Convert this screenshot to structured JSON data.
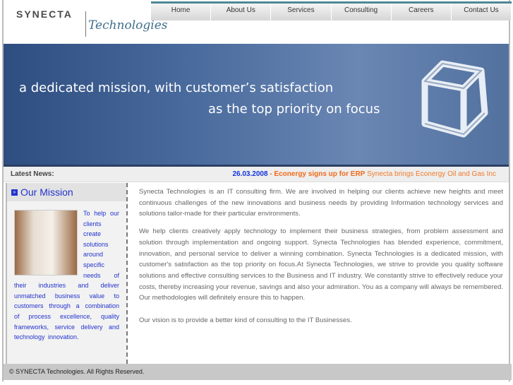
{
  "logo": {
    "name": "SYNECTA",
    "sub": "Technologies"
  },
  "nav": [
    "Home",
    "About Us",
    "Services",
    "Consulting",
    "Careers",
    "Contact Us"
  ],
  "banner": {
    "line1": "a dedicated mission, with customer’s satisfaction",
    "line2": "as the top priority on focus"
  },
  "news": {
    "label": "Latest News:",
    "date": "26.03.2008",
    "sep": " - ",
    "headline": "Econergy signs up for ERP",
    "text": " Synecta brings Econergy Oil and Gas Inc"
  },
  "sidebar": {
    "title": "Our Mission",
    "text": "To help our clients create solutions around specific needs of their industries and deliver unmatched business value to customers through a combination of process excellence, quality frameworks, service delivery and technology innovation."
  },
  "main": {
    "paragraphs": [
      "Synecta Technologies is an IT consulting firm. We are involved in helping our clients achieve new heights and meet continuous challenges of the new innovations and business needs by providing Information technology services and solutions tailor-made for their particular environments.",
      "We help clients creatively apply technology to implement their business strategies, from problem assessment and solution through implementation and ongoing support. Synecta Technologies has blended experience, commitment, innovation, and personal service to deliver a winning combination. Synecta Technologies is a dedicated mission, with customer's satisfaction as the top priority on focus.At Synecta Technologies, we strive to provide you quality software solutions and effective consulting services to the Business and IT industry. We constantly strive to effectively reduce your costs, thereby increasing your revenue, savings and also your admiration. You as a company will always be remembered. Our methodologies will definitely ensure this to happen.",
      "Our vision is to provide a better kind of consulting to the IT Businesses."
    ]
  },
  "footer": "© SYNECTA Technologies. All Rights Reserved."
}
